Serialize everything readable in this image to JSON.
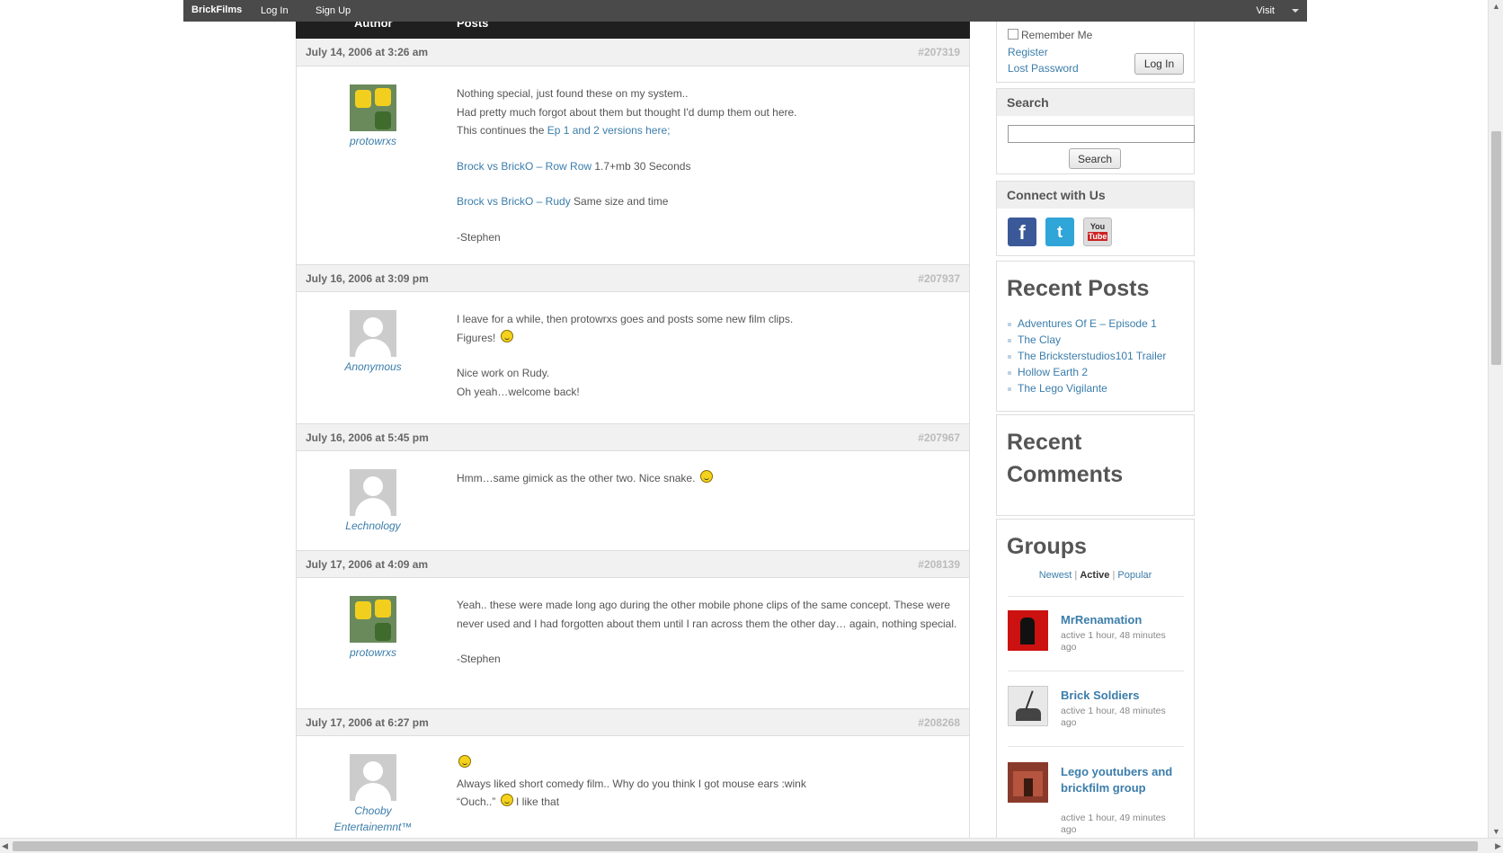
{
  "adminbar": {
    "brand": "BrickFilms",
    "login": "Log In",
    "signup": "Sign Up",
    "visit": "Visit"
  },
  "table_head": {
    "author": "Author",
    "posts": "Posts"
  },
  "posts": [
    {
      "date": "July 14, 2006 at 3:26 am",
      "id": "#207319",
      "author": "protowrxs",
      "lines": [
        "Nothing special, just found these on my system..",
        "Had pretty much forgot about them but thought I'd dump them out here."
      ],
      "continues_prefix": "This continues the ",
      "continues_link": "Ep 1 and 2 versions here;",
      "link1": "Brock vs BrickO – Row Row",
      "link1_suffix": " 1.7+mb 30 Seconds",
      "link2": "Brock vs BrickO – Rudy",
      "link2_suffix": " Same size and time",
      "sig": "-Stephen"
    },
    {
      "date": "July 16, 2006 at 3:09 pm",
      "id": "#207937",
      "author": "Anonymous",
      "line1": "I leave for a while, then protowrxs goes and posts some new film clips.",
      "line2": "Figures!",
      "line3": "Nice work on Rudy.",
      "line4": "Oh yeah…welcome back!"
    },
    {
      "date": "July 16, 2006 at 5:45 pm",
      "id": "#207967",
      "author": "Lechnology",
      "line1": "Hmm…same gimick as the other two. Nice snake."
    },
    {
      "date": "July 17, 2006 at 4:09 am",
      "id": "#208139",
      "author": "protowrxs",
      "text": "Yeah.. these were made long ago during the other mobile phone clips of the same concept. These were never used and I had forgotten about them until I ran across them the other day… again, nothing special.",
      "sig": "-Stephen"
    },
    {
      "date": "July 17, 2006 at 6:27 pm",
      "id": "#208268",
      "author": "Chooby Entertainemnt™",
      "line1": "Always liked short comedy film.. Why do you think I got mouse ears :wink",
      "line2_prefix": "“Ouch..” ",
      "line2_suffix": " I like that"
    }
  ],
  "sidebar": {
    "login": {
      "remember": "Remember Me",
      "register": "Register",
      "lost": "Lost Password",
      "button": "Log In"
    },
    "search": {
      "title": "Search",
      "button": "Search"
    },
    "connect": {
      "title": "Connect with Us",
      "facebook_icon": "f",
      "twitter_icon": "t",
      "youtube_you": "You",
      "youtube_tube": "Tube"
    },
    "recent_posts": {
      "title": "Recent Posts",
      "items": [
        "Adventures Of E – Episode 1",
        "The Clay",
        "The Bricksterstudios101 Trailer",
        "Hollow Earth 2",
        "The Lego Vigilante"
      ]
    },
    "recent_comments": {
      "title_line1": "Recent",
      "title_line2": "Comments"
    },
    "groups": {
      "title": "Groups",
      "tabs": {
        "newest": "Newest",
        "active": "Active",
        "popular": "Popular"
      },
      "items": [
        {
          "name": "MrRenamation",
          "activity": "active 1 hour, 48 minutes ago"
        },
        {
          "name": "Brick Soldiers",
          "activity": "active 1 hour, 48 minutes ago"
        },
        {
          "name": "Lego youtubers and brickfilm group",
          "activity": "active 1 hour, 49 minutes ago"
        }
      ]
    }
  },
  "colors": {
    "link": "#3b7dab",
    "header_bg": "#1f1f1f",
    "adminbar_bg": "#4a4a4a"
  }
}
